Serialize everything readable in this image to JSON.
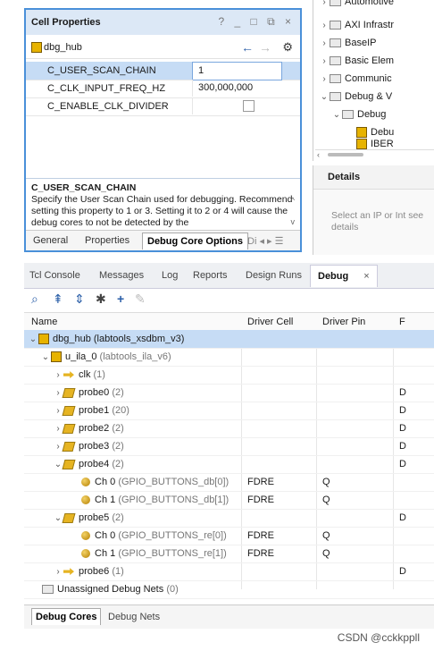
{
  "cell_properties": {
    "title": "Cell Properties",
    "window_buttons": "? _ □ ⧉ ×",
    "object_name": "dbg_hub",
    "nav_back": "←",
    "nav_forward": "→",
    "settings_icon": "gear-icon",
    "props": [
      {
        "name": "C_USER_SCAN_CHAIN",
        "value": "1"
      },
      {
        "name": "C_CLK_INPUT_FREQ_HZ",
        "value": "300,000,000"
      },
      {
        "name": "C_ENABLE_CLK_DIVIDER",
        "value": ""
      }
    ],
    "desc_title": "C_USER_SCAN_CHAIN",
    "desc_text": "Specify the User Scan Chain used for debugging. Recommend setting this property to 1 or 3. Setting it to 2 or 4 will cause the debug cores to not be detected by the",
    "tabs": {
      "general": "General",
      "properties": "Properties",
      "debug_core_options": "Debug Core Options",
      "more": "Di ◂ ▸ ☰"
    }
  },
  "ip_tree": {
    "items": [
      {
        "label": "Automotive"
      },
      {
        "label": "AXI Infrastr"
      },
      {
        "label": "BaseIP"
      },
      {
        "label": "Basic Elem"
      },
      {
        "label": "Communic"
      },
      {
        "label": "Debug & V"
      },
      {
        "label": "Debug"
      },
      {
        "label": "Debu"
      },
      {
        "label": "IBER"
      }
    ]
  },
  "details": {
    "title": "Details",
    "hint": "Select an IP or Int see details"
  },
  "debug_panel": {
    "tabs": [
      "Tcl Console",
      "Messages",
      "Log",
      "Reports",
      "Design Runs",
      "Debug"
    ],
    "close": "×",
    "columns": {
      "name": "Name",
      "driver_cell": "Driver Cell",
      "driver_pin": "Driver Pin",
      "f": "F"
    },
    "rows": [
      {
        "label": "dbg_hub",
        "meta": "(labtools_xsdbm_v3)",
        "cell": "",
        "pin": "",
        "f": ""
      },
      {
        "label": "u_ila_0",
        "meta": "(labtools_ila_v6)",
        "cell": "",
        "pin": "",
        "f": ""
      },
      {
        "label": "clk",
        "meta": "(1)",
        "cell": "",
        "pin": "",
        "f": ""
      },
      {
        "label": "probe0",
        "meta": "(2)",
        "cell": "",
        "pin": "",
        "f": "D"
      },
      {
        "label": "probe1",
        "meta": "(20)",
        "cell": "",
        "pin": "",
        "f": "D"
      },
      {
        "label": "probe2",
        "meta": "(2)",
        "cell": "",
        "pin": "",
        "f": "D"
      },
      {
        "label": "probe3",
        "meta": "(2)",
        "cell": "",
        "pin": "",
        "f": "D"
      },
      {
        "label": "probe4",
        "meta": "(2)",
        "cell": "",
        "pin": "",
        "f": "D"
      },
      {
        "label": "Ch 0",
        "meta": "(GPIO_BUTTONS_db[0])",
        "cell": "FDRE",
        "pin": "Q",
        "f": ""
      },
      {
        "label": "Ch 1",
        "meta": "(GPIO_BUTTONS_db[1])",
        "cell": "FDRE",
        "pin": "Q",
        "f": ""
      },
      {
        "label": "probe5",
        "meta": "(2)",
        "cell": "",
        "pin": "",
        "f": "D"
      },
      {
        "label": "Ch 0",
        "meta": "(GPIO_BUTTONS_re[0])",
        "cell": "FDRE",
        "pin": "Q",
        "f": ""
      },
      {
        "label": "Ch 1",
        "meta": "(GPIO_BUTTONS_re[1])",
        "cell": "FDRE",
        "pin": "Q",
        "f": ""
      },
      {
        "label": "probe6",
        "meta": "(1)",
        "cell": "",
        "pin": "",
        "f": "D"
      },
      {
        "label": "Unassigned Debug Nets",
        "meta": "(0)",
        "cell": "",
        "pin": "",
        "f": ""
      }
    ],
    "bottom_tabs": {
      "debug_cores": "Debug Cores",
      "debug_nets": "Debug Nets"
    }
  },
  "watermark": "CSDN @cckkppll"
}
